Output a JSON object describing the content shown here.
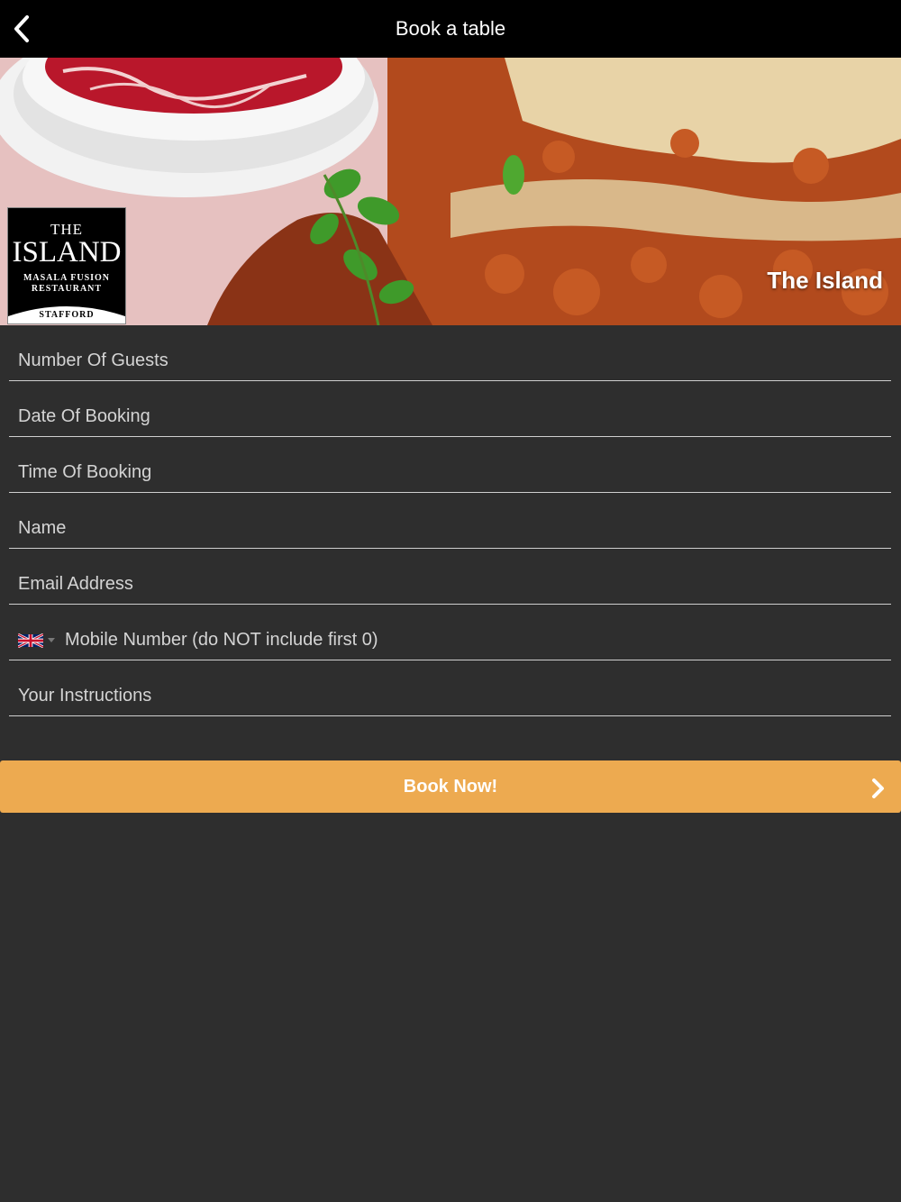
{
  "navbar": {
    "title": "Book a table",
    "back_icon": "chevron-left-icon"
  },
  "hero": {
    "caption": "The Island",
    "logo": {
      "line1": "THE",
      "line2": "ISLAND",
      "line3": "MASALA FUSION",
      "line4": "RESTAURANT",
      "line5": "STAFFORD"
    }
  },
  "form": {
    "guests_placeholder": "Number Of Guests",
    "date_placeholder": "Date Of Booking",
    "time_placeholder": "Time Of Booking",
    "name_placeholder": "Name",
    "email_placeholder": "Email Address",
    "mobile_placeholder": "Mobile Number (do NOT include first 0)",
    "mobile_country_icon": "uk-flag-icon",
    "instructions_placeholder": "Your Instructions"
  },
  "submit": {
    "label": "Book Now!",
    "icon": "chevron-right-icon"
  },
  "colors": {
    "navbar_bg": "#000000",
    "page_bg": "#2e2e2e",
    "button_bg": "#edaa50",
    "field_line": "#cfcfcf"
  }
}
